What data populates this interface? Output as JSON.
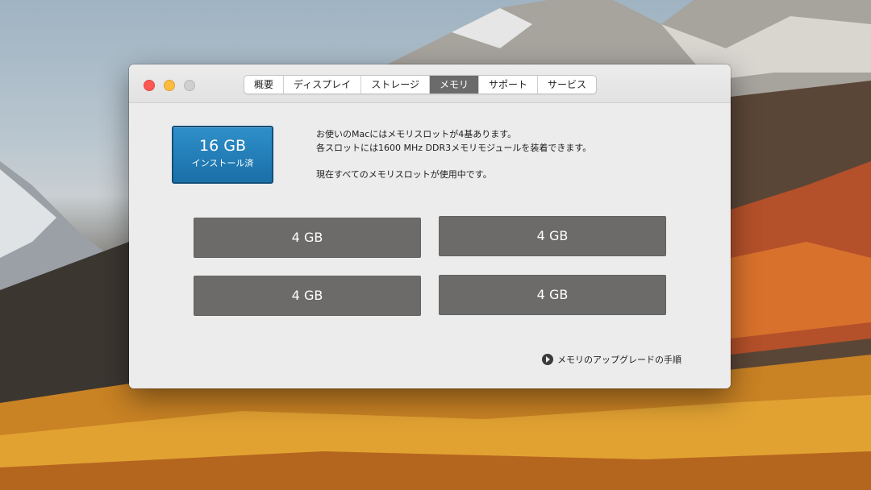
{
  "window": {
    "tabs": [
      {
        "label": "概要",
        "active": false
      },
      {
        "label": "ディスプレイ",
        "active": false
      },
      {
        "label": "ストレージ",
        "active": false
      },
      {
        "label": "メモリ",
        "active": true
      },
      {
        "label": "サポート",
        "active": false
      },
      {
        "label": "サービス",
        "active": false
      }
    ]
  },
  "memory": {
    "total_size": "16 GB",
    "total_label": "インストール済",
    "info_line1": "お使いのMacにはメモリスロットが4基あります。",
    "info_line2": "各スロットには1600 MHz DDR3メモリモジュールを装着できます。",
    "info_line3": "現在すべてのメモリスロットが使用中です。",
    "slots": [
      "4 GB",
      "4 GB",
      "4 GB",
      "4 GB"
    ],
    "upgrade_link": "メモリのアップグレードの手順"
  },
  "colors": {
    "badge": "#1f78b4",
    "slot": "#6d6b69",
    "active_tab": "#6b6b6b",
    "close": "#fc5753",
    "minimize": "#fdbc40"
  }
}
